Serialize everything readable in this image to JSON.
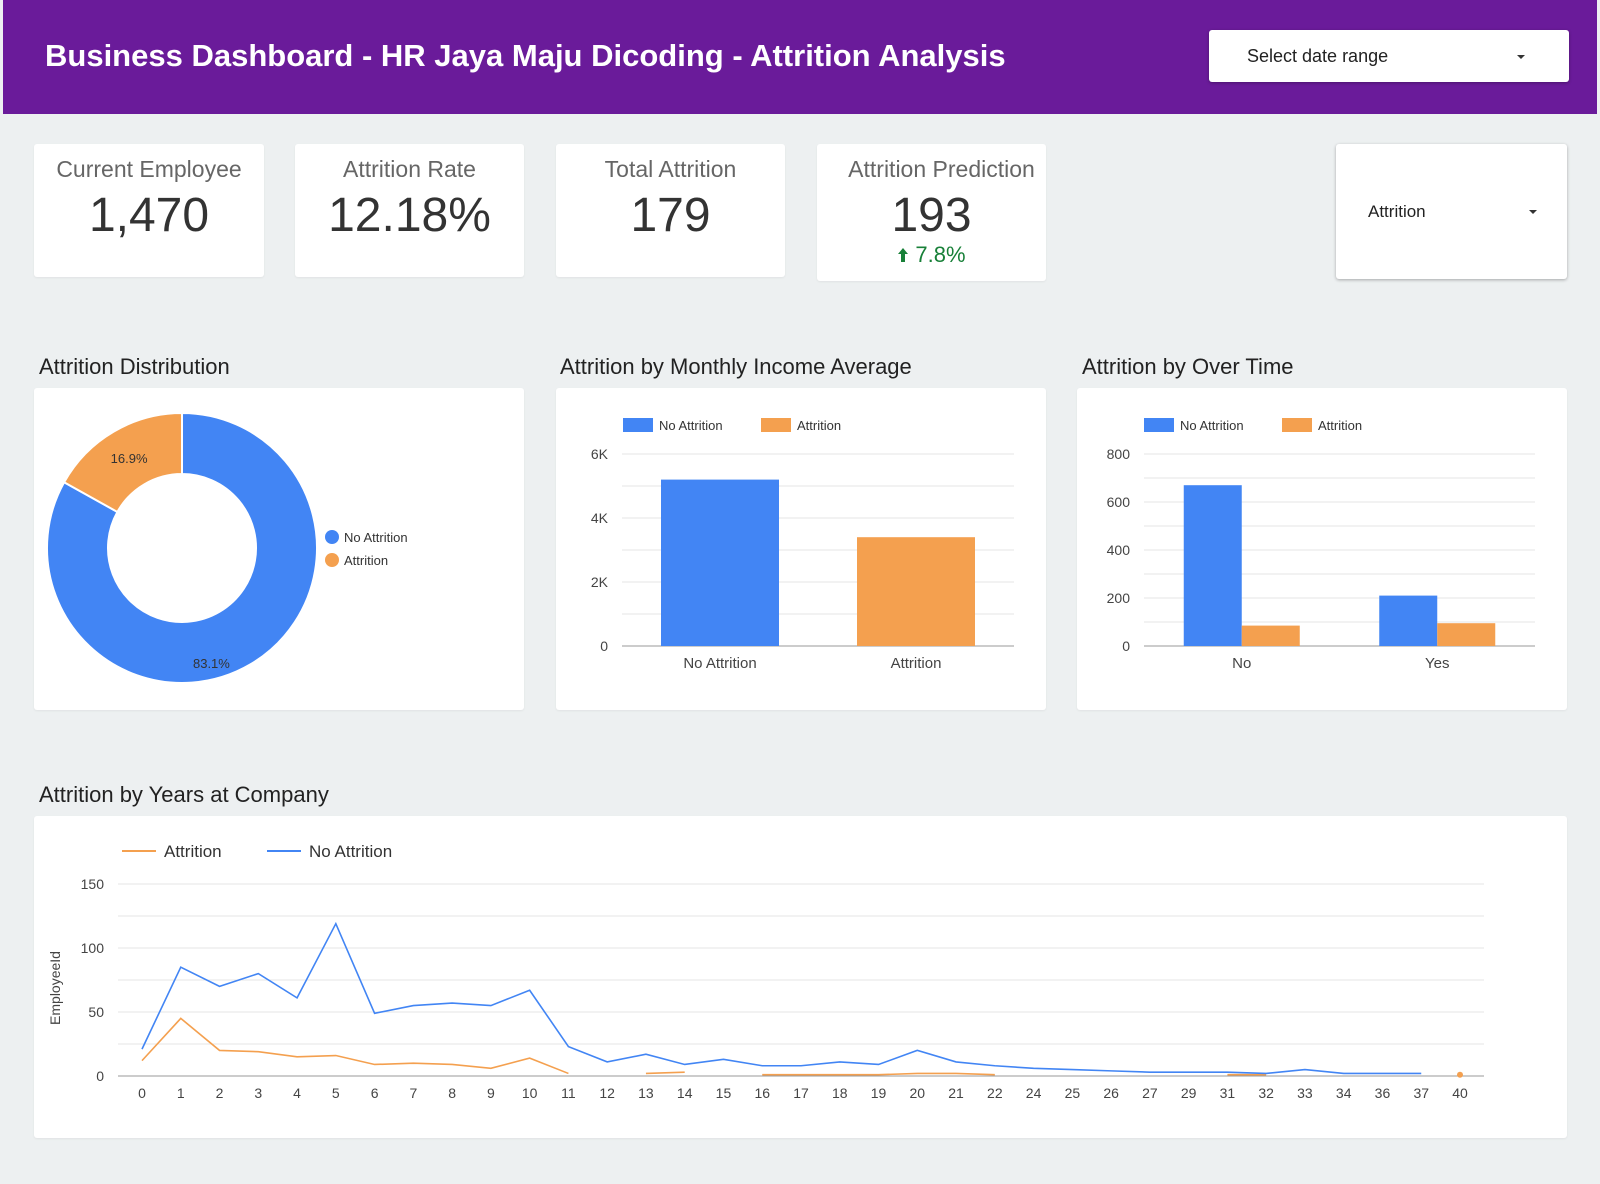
{
  "header": {
    "title": "Business Dashboard - HR Jaya Maju Dicoding - Attrition Analysis",
    "date_range_label": "Select date range"
  },
  "kpis": [
    {
      "label": "Current Employee",
      "value": "1,470"
    },
    {
      "label": "Attrition Rate",
      "value": "12.18%"
    },
    {
      "label": "Total Attrition",
      "value": "179"
    },
    {
      "label": "Attrition Prediction",
      "value": "193",
      "delta": "7.8%"
    }
  ],
  "filter": {
    "label": "Attrition"
  },
  "colors": {
    "no_attrition": "#4285f4",
    "attrition": "#f4a04f",
    "header": "#6a1b9a",
    "positive": "#188038"
  },
  "sections": {
    "distribution": "Attrition Distribution",
    "income": "Attrition by Monthly Income Average",
    "overtime": "Attrition by Over Time",
    "years": "Attrition by Years at Company"
  },
  "chart_data": [
    {
      "type": "pie",
      "title": "Attrition Distribution",
      "donut": true,
      "labels": [
        "No Attrition",
        "Attrition"
      ],
      "values": [
        83.1,
        16.9
      ],
      "value_labels": [
        "83.1%",
        "16.9%"
      ],
      "legend": "right"
    },
    {
      "type": "bar",
      "title": "Attrition by Monthly Income Average",
      "categories": [
        "No Attrition",
        "Attrition"
      ],
      "series": [
        {
          "name": "No Attrition",
          "values": [
            5200,
            null
          ]
        },
        {
          "name": "Attrition",
          "values": [
            null,
            3400
          ]
        }
      ],
      "yticks": [
        "0",
        "2K",
        "4K",
        "6K"
      ],
      "ylim": [
        0,
        6000
      ],
      "legend": "top"
    },
    {
      "type": "bar",
      "title": "Attrition by Over Time",
      "categories": [
        "No",
        "Yes"
      ],
      "series": [
        {
          "name": "No Attrition",
          "values": [
            670,
            210
          ]
        },
        {
          "name": "Attrition",
          "values": [
            85,
            95
          ]
        }
      ],
      "yticks": [
        "0",
        "200",
        "400",
        "600",
        "800"
      ],
      "ylim": [
        0,
        800
      ],
      "legend": "top"
    },
    {
      "type": "line",
      "title": "Attrition by Years at Company",
      "ylabel": "EmployeeId",
      "ylim": [
        0,
        150
      ],
      "yticks": [
        "0",
        "50",
        "100",
        "150"
      ],
      "x": [
        "0",
        "1",
        "2",
        "3",
        "4",
        "5",
        "6",
        "7",
        "8",
        "9",
        "10",
        "11",
        "12",
        "13",
        "14",
        "15",
        "16",
        "17",
        "18",
        "19",
        "20",
        "21",
        "22",
        "24",
        "25",
        "26",
        "27",
        "29",
        "31",
        "32",
        "33",
        "34",
        "36",
        "37",
        "40"
      ],
      "series": [
        {
          "name": "Attrition",
          "values": [
            12,
            45,
            20,
            19,
            15,
            16,
            9,
            10,
            9,
            6,
            14,
            2,
            null,
            2,
            3,
            null,
            1,
            1,
            1,
            1,
            2,
            2,
            1,
            null,
            null,
            null,
            null,
            null,
            1,
            1,
            null,
            null,
            null,
            null,
            1
          ]
        },
        {
          "name": "No Attrition",
          "values": [
            21,
            85,
            70,
            80,
            61,
            119,
            49,
            55,
            57,
            55,
            67,
            23,
            11,
            17,
            9,
            13,
            8,
            8,
            11,
            9,
            20,
            11,
            8,
            6,
            5,
            4,
            3,
            3,
            3,
            2,
            5,
            2,
            2,
            2,
            null
          ]
        }
      ],
      "legend": "top-left"
    }
  ]
}
